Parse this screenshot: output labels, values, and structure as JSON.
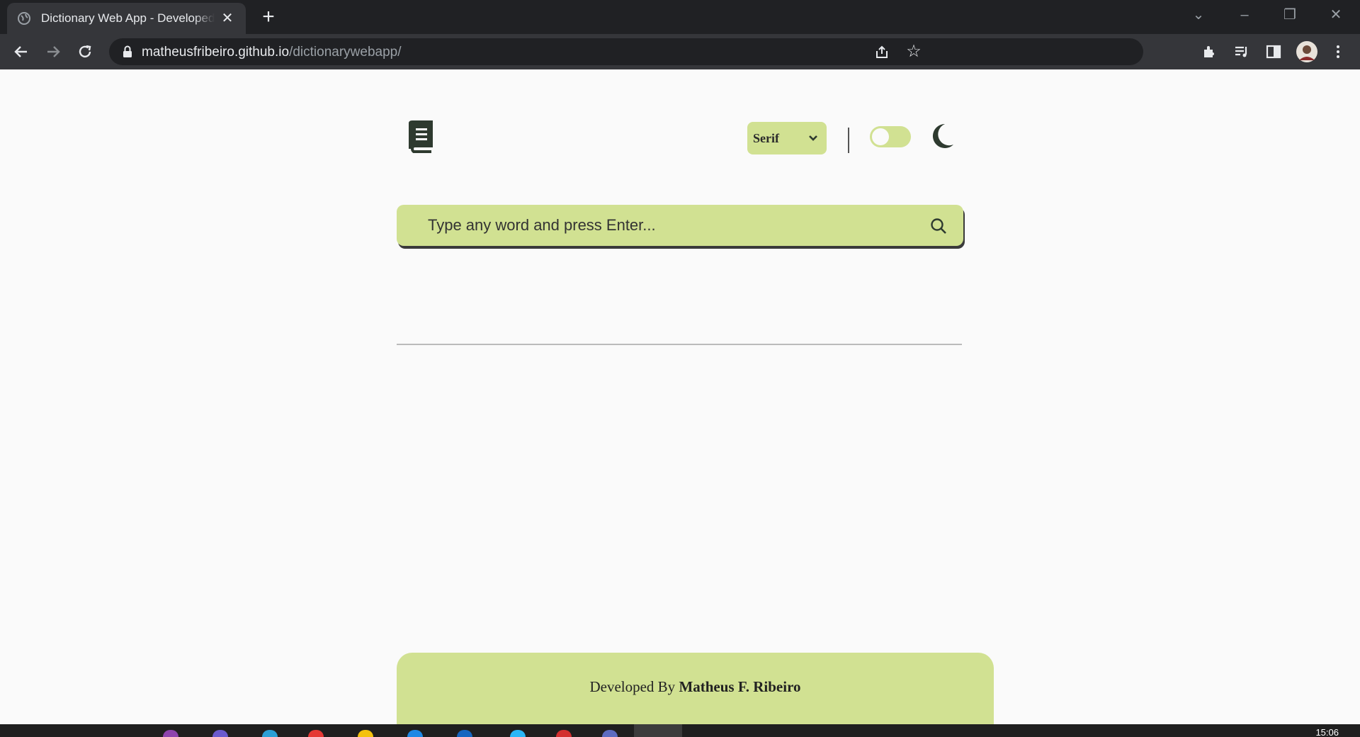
{
  "browser": {
    "tab_title": "Dictionary Web App - Developed By Matheus F. Ribeiro",
    "url_host": "matheusfribeiro.github.io",
    "url_path": "/dictionarywebapp/"
  },
  "header": {
    "font_selected": "Serif",
    "theme_toggle_on": false
  },
  "search": {
    "placeholder": "Type any word and press Enter..."
  },
  "footer": {
    "prefix": "Developed By ",
    "author": "Matheus F. Ribeiro"
  },
  "taskbar": {
    "clock": "15:06"
  },
  "colors": {
    "accent": "#d1e192",
    "page_bg": "#fafafa",
    "icon_dark": "#2e3a2f"
  }
}
